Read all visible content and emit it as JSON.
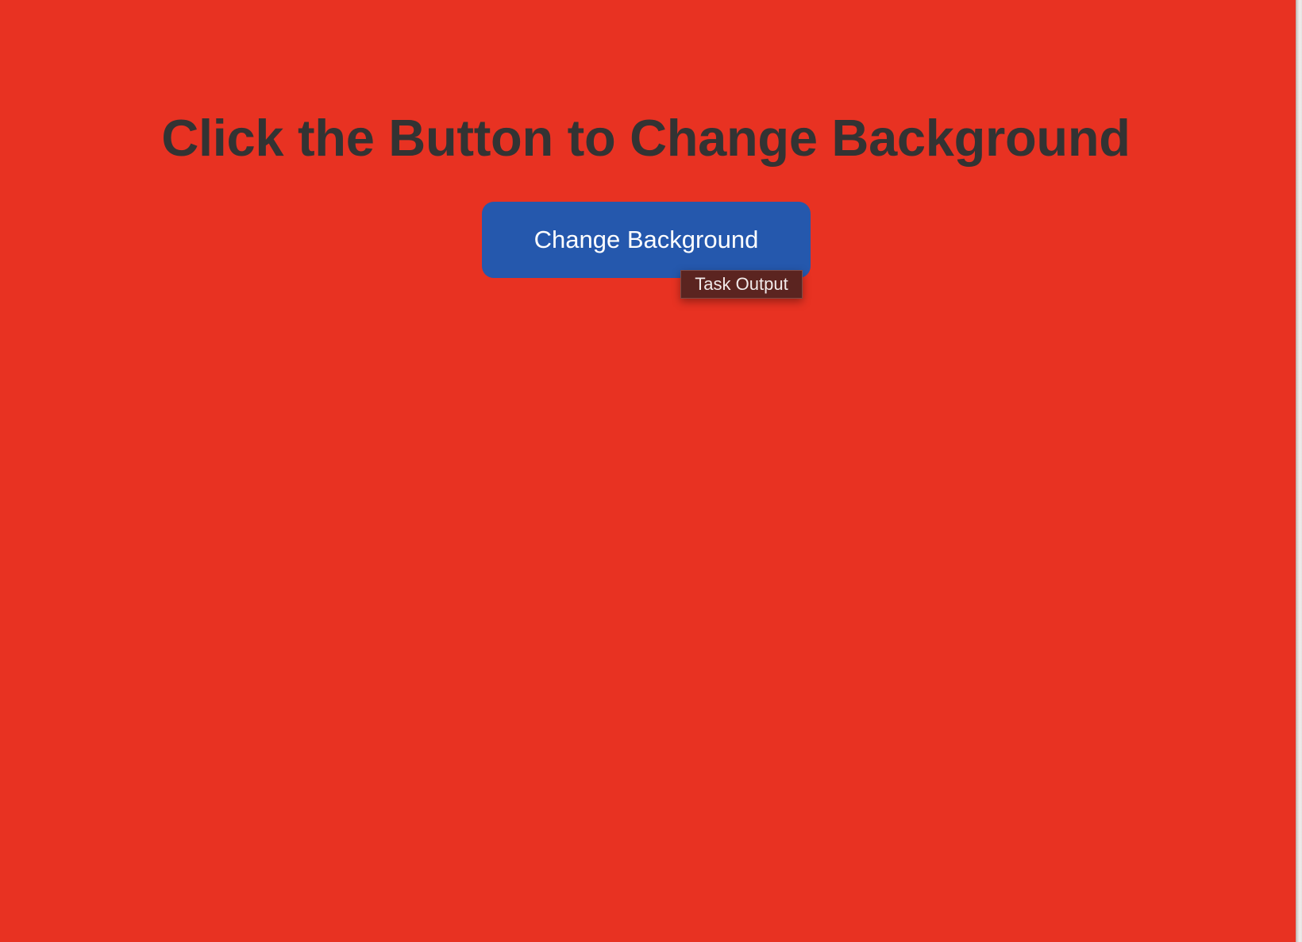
{
  "page": {
    "title": "Click the Button to Change Background",
    "background_color": "#e83222"
  },
  "button": {
    "label": "Change Background",
    "color": "#2558ad",
    "text_color": "#ffffff"
  },
  "tooltip": {
    "text": "Task Output",
    "color": "#5b2420"
  }
}
